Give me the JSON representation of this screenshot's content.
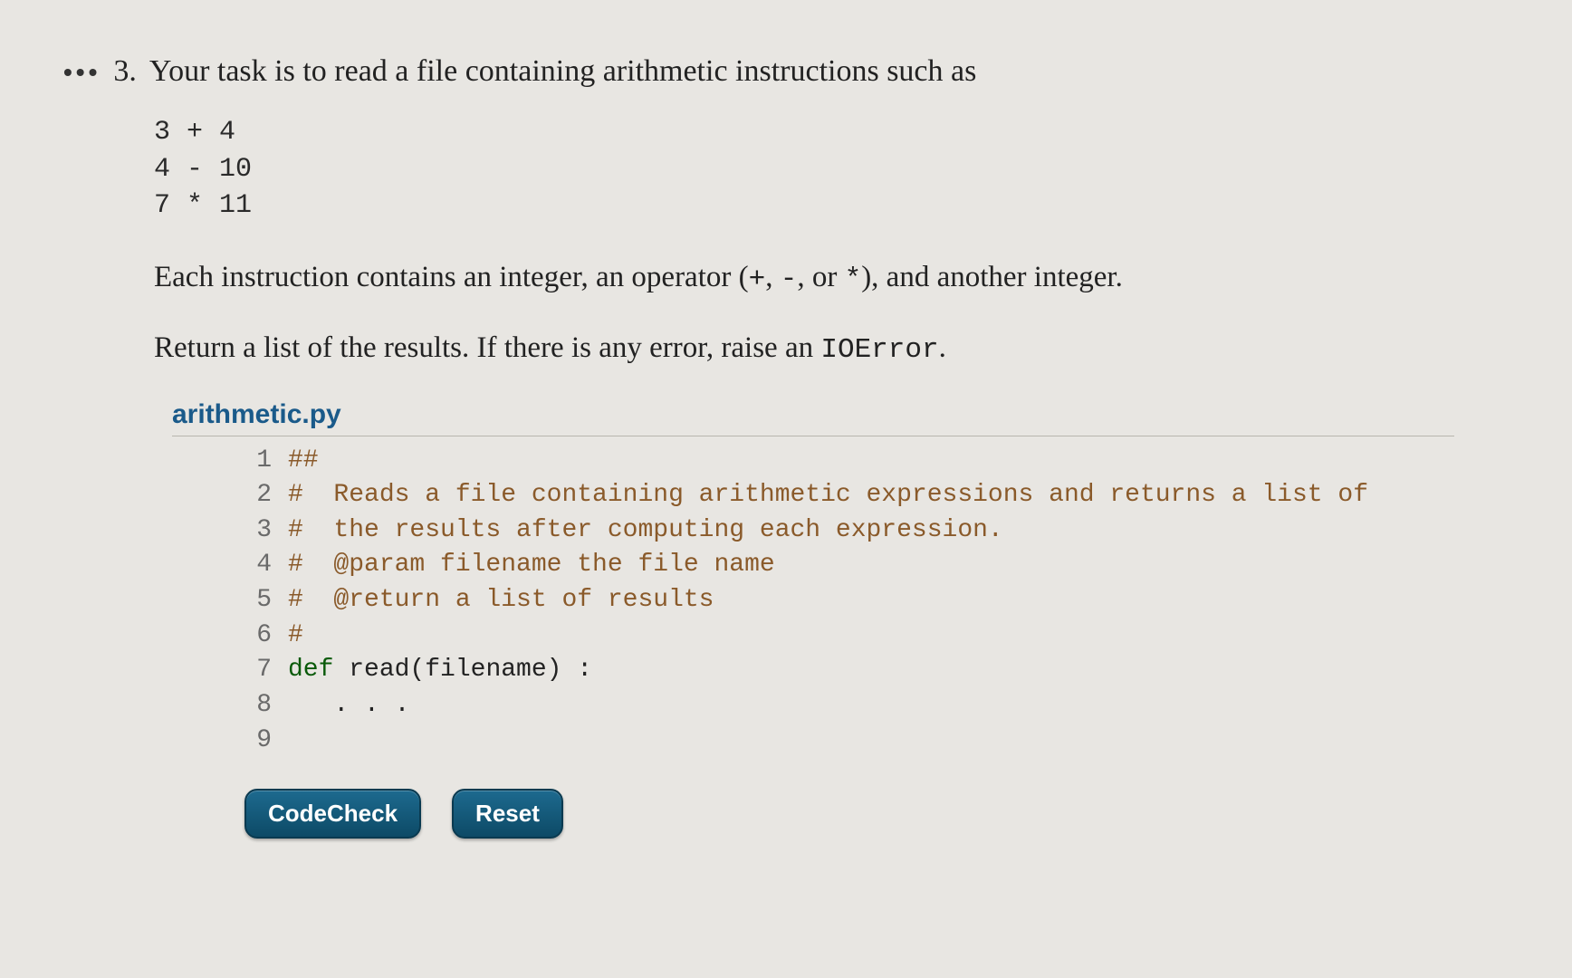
{
  "problem": {
    "bullets": "•••",
    "number": "3.",
    "intro": "Your task is to read a file containing arithmetic instructions such as",
    "example_lines": [
      "3 + 4",
      "4 - 10",
      "7 * 11"
    ],
    "desc_before_ops": "Each instruction contains an integer, an operator (",
    "op_plus": "+",
    "comma1": ", ",
    "op_minus": "-",
    "comma2": ", or ",
    "op_star": "*",
    "desc_after_ops": "), and another integer.",
    "result_before": "Return a list of the results. If there is any error, raise an ",
    "ioerror": "IOError",
    "result_after": "."
  },
  "file": {
    "name": "arithmetic.py"
  },
  "code": {
    "lines": [
      {
        "n": "1",
        "segs": [
          {
            "cls": "tok-comment",
            "t": "##"
          }
        ]
      },
      {
        "n": "2",
        "segs": [
          {
            "cls": "tok-comment",
            "t": "#  Reads a file containing arithmetic expressions and returns a list of"
          }
        ]
      },
      {
        "n": "3",
        "segs": [
          {
            "cls": "tok-comment",
            "t": "#  the results after computing each expression."
          }
        ]
      },
      {
        "n": "4",
        "segs": [
          {
            "cls": "tok-comment",
            "t": "#  @param filename the file name"
          }
        ]
      },
      {
        "n": "5",
        "segs": [
          {
            "cls": "tok-comment",
            "t": "#  @return a list of results"
          }
        ]
      },
      {
        "n": "6",
        "segs": [
          {
            "cls": "tok-comment",
            "t": "#"
          }
        ]
      },
      {
        "n": "7",
        "segs": [
          {
            "cls": "tok-keyword",
            "t": "def"
          },
          {
            "cls": "tok-plain",
            "t": " read(filename) :"
          }
        ]
      },
      {
        "n": "8",
        "segs": [
          {
            "cls": "tok-plain",
            "t": "   . . ."
          }
        ]
      },
      {
        "n": "9",
        "segs": [
          {
            "cls": "tok-plain",
            "t": ""
          }
        ]
      }
    ]
  },
  "buttons": {
    "codecheck": "CodeCheck",
    "reset": "Reset"
  }
}
